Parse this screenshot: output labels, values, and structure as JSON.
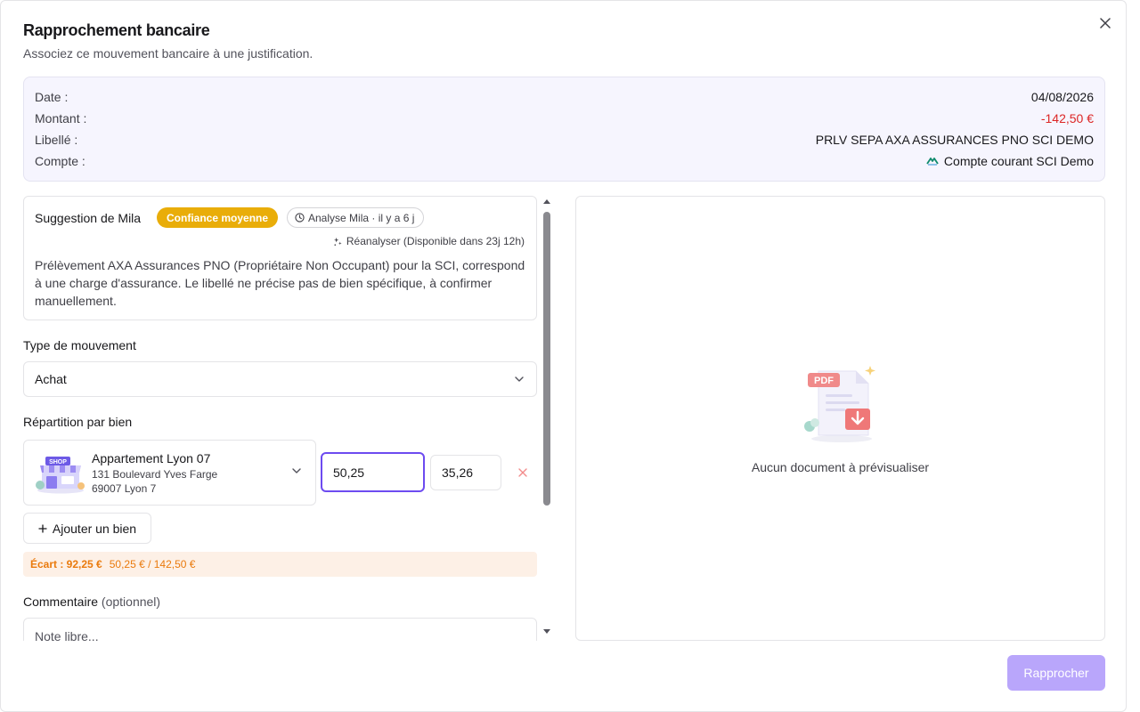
{
  "dialog": {
    "title": "Rapprochement bancaire",
    "subtitle": "Associez ce mouvement bancaire à une justification.",
    "close_icon": "close-icon"
  },
  "transaction": {
    "date_label": "Date :",
    "date_value": "04/08/2026",
    "amount_label": "Montant :",
    "amount_value": "-142,50 €",
    "amount_color": "#dc2626",
    "wording_label": "Libellé :",
    "wording_value": "PRLV SEPA AXA ASSURANCES PNO SCI DEMO",
    "account_label": "Compte :",
    "account_value": "Compte courant SCI Demo",
    "account_icon": "bank-logo-icon"
  },
  "suggestion": {
    "title": "Suggestion de Mila",
    "confidence_badge": "Confiance moyenne",
    "confidence_color": "#e9ad09",
    "analysis_badge": "Analyse Mila · il y a 6 j",
    "analysis_icon": "clock-icon",
    "reanalyze_label": "Réanalyser (Disponible dans 23j 12h)",
    "reanalyze_icon": "sparkles-icon",
    "text": "Prélèvement AXA Assurances PNO (Propriétaire Non Occupant) pour la SCI, correspond à une charge d'assurance. Le libellé ne précise pas de bien spécifique, à confirmer manuellement."
  },
  "movement_type": {
    "label": "Type de mouvement",
    "selected": "Achat"
  },
  "allocation": {
    "label": "Répartition par bien",
    "property": {
      "name": "Appartement Lyon 07",
      "address_line1": "131 Boulevard Yves Farge",
      "address_line2": "69007 Lyon 7",
      "image_icon": "shop-building-icon",
      "image_text": "SHOP"
    },
    "amount": "50,25",
    "second_value": "35,26",
    "add_label": "Ajouter un bien",
    "gap_label": "Écart : 92,25 €",
    "gap_detail": "50,25 € / 142,50 €"
  },
  "comment": {
    "label": "Commentaire",
    "optional": "(optionnel)",
    "placeholder": "Note libre..."
  },
  "preview": {
    "illustration_icon": "pdf-document-icon",
    "pdf_text": "PDF",
    "empty_text": "Aucun document à prévisualiser"
  },
  "actions": {
    "submit_label": "Rapprocher",
    "submit_color": "#b9a6fb"
  }
}
